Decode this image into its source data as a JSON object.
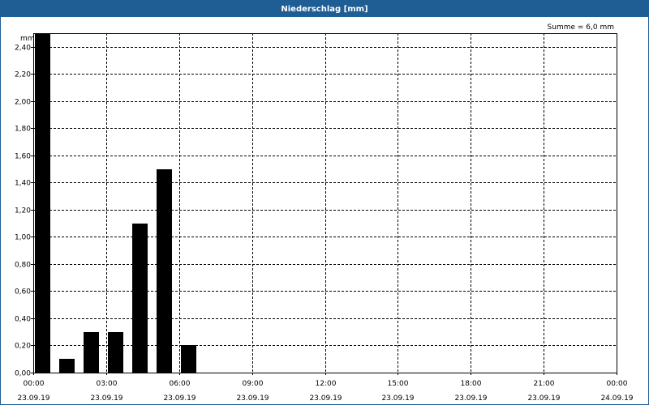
{
  "window": {
    "title": "Niederschlag [mm]"
  },
  "summary": "Summe = 6,0 mm",
  "colors": {
    "title_bar": "#1f5d95",
    "title_text": "#ffffff",
    "bars": "#000000",
    "grid": "#000000"
  },
  "chart_data": {
    "type": "bar",
    "title": "Niederschlag [mm]",
    "ylabel": "mm",
    "xlabel": "",
    "ylim": [
      0,
      2.5
    ],
    "y_ticks": [
      {
        "value": 0,
        "label": "0,00"
      },
      {
        "value": 0.2,
        "label": "0,20"
      },
      {
        "value": 0.4,
        "label": "0,40"
      },
      {
        "value": 0.6,
        "label": "0,60"
      },
      {
        "value": 0.8,
        "label": "0,80"
      },
      {
        "value": 1.0,
        "label": "1,00"
      },
      {
        "value": 1.2,
        "label": "1,20"
      },
      {
        "value": 1.4,
        "label": "1,40"
      },
      {
        "value": 1.6,
        "label": "1,60"
      },
      {
        "value": 1.8,
        "label": "1,80"
      },
      {
        "value": 2.0,
        "label": "2,00"
      },
      {
        "value": 2.2,
        "label": "2,20"
      },
      {
        "value": 2.4,
        "label": "2,40"
      }
    ],
    "x_range": [
      "23.09.19 00:00",
      "24.09.19 00:00"
    ],
    "x_ticks": [
      {
        "time": "00:00",
        "date": "23.09.19"
      },
      {
        "time": "03:00",
        "date": "23.09.19"
      },
      {
        "time": "06:00",
        "date": "23.09.19"
      },
      {
        "time": "09:00",
        "date": "23.09.19"
      },
      {
        "time": "12:00",
        "date": "23.09.19"
      },
      {
        "time": "15:00",
        "date": "23.09.19"
      },
      {
        "time": "18:00",
        "date": "23.09.19"
      },
      {
        "time": "21:00",
        "date": "23.09.19"
      },
      {
        "time": "00:00",
        "date": "24.09.19"
      }
    ],
    "categories": [
      "00:00",
      "01:00",
      "02:00",
      "03:00",
      "04:00",
      "05:00",
      "06:00"
    ],
    "values": [
      2.5,
      0.1,
      0.3,
      0.3,
      1.1,
      1.5,
      0.2
    ],
    "grid": true,
    "legend": "none"
  }
}
